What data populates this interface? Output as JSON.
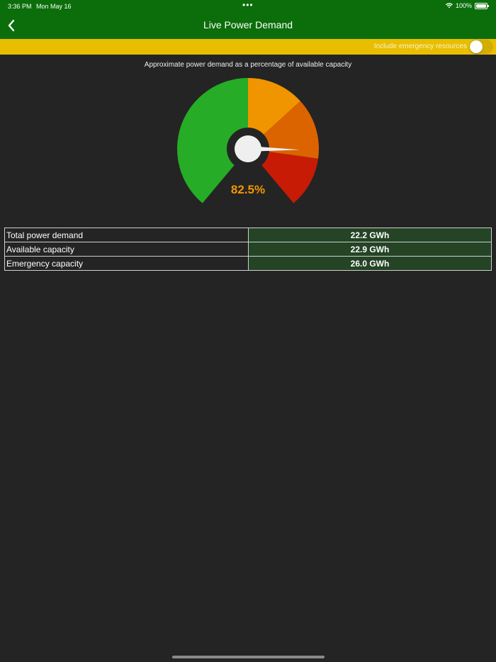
{
  "status_bar": {
    "time": "3:36 PM",
    "date": "Mon May 16",
    "dots": "•••",
    "battery": "100%"
  },
  "nav": {
    "title": "Live Power Demand",
    "back_icon": "chevron-left-icon"
  },
  "emergency_toggle": {
    "label": "Include emergency resources",
    "on": false
  },
  "gauge": {
    "subtitle": "Approximate power demand as a percentage of available capacity",
    "value_label": "82.5%",
    "value": 82.5,
    "min": 0,
    "max": 100,
    "zones": [
      {
        "from": 0,
        "to": 50,
        "color": "#26ac26"
      },
      {
        "from": 50,
        "to": 67,
        "color": "#f09400"
      },
      {
        "from": 67,
        "to": 85,
        "color": "#db6300"
      },
      {
        "from": 85,
        "to": 100,
        "color": "#c71b05"
      }
    ],
    "needle_color": "#f2f2f2",
    "value_color": "#f29600"
  },
  "table": {
    "rows": [
      {
        "label": "Total power demand",
        "value": "22.2 GWh"
      },
      {
        "label": "Available capacity",
        "value": "22.9 GWh"
      },
      {
        "label": "Emergency capacity",
        "value": "26.0 GWh"
      }
    ]
  },
  "colors": {
    "header": "#0b6e0b",
    "toggle_bar": "#e9be00",
    "background": "#242424",
    "value_cell": "#244425"
  }
}
